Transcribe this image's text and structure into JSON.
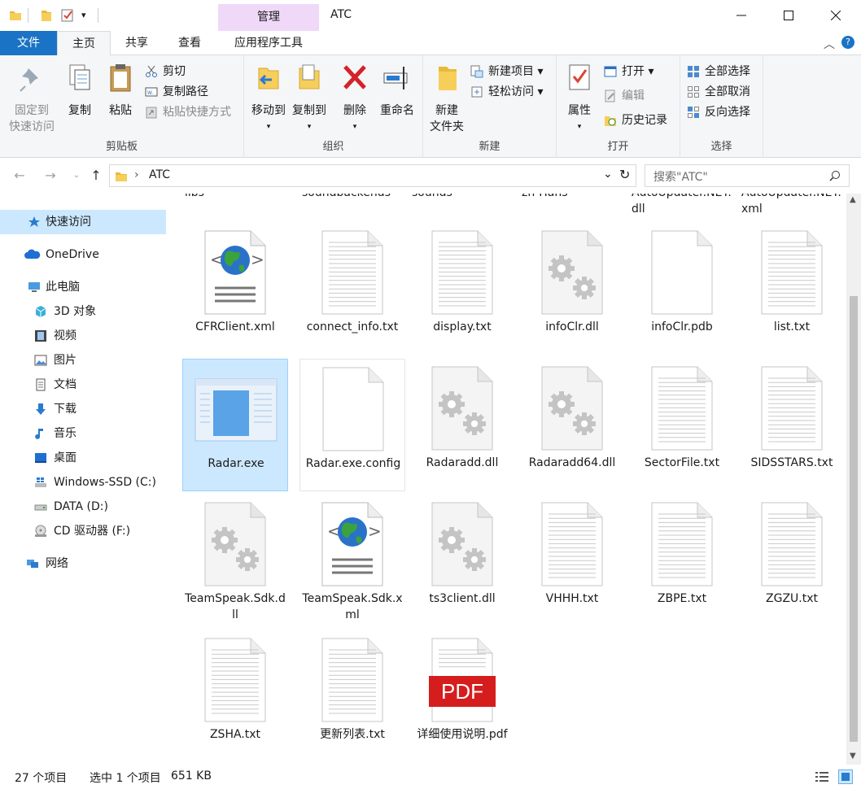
{
  "window": {
    "title": "ATC",
    "context_tab": "管理"
  },
  "tabs": {
    "file": "文件",
    "home": "主页",
    "share": "共享",
    "view": "查看",
    "app_tools": "应用程序工具"
  },
  "ribbon": {
    "clipboard": {
      "label": "剪贴板",
      "pin_line1": "固定到",
      "pin_line2": "快速访问",
      "copy": "复制",
      "paste": "粘贴",
      "cut": "剪切",
      "copy_path": "复制路径",
      "paste_shortcut": "粘贴快捷方式"
    },
    "organize": {
      "label": "组织",
      "move_to": "移动到",
      "copy_to": "复制到",
      "delete": "删除",
      "rename": "重命名"
    },
    "new": {
      "label": "新建",
      "new_folder_line1": "新建",
      "new_folder_line2": "文件夹",
      "new_item": "新建项目",
      "easy_access": "轻松访问"
    },
    "open": {
      "label": "打开",
      "properties": "属性",
      "open": "打开",
      "edit": "编辑",
      "history": "历史记录"
    },
    "select": {
      "label": "选择",
      "select_all": "全部选择",
      "select_none": "全部取消",
      "invert": "反向选择"
    }
  },
  "address": {
    "path": "ATC",
    "search_placeholder": "搜索\"ATC\""
  },
  "nav": {
    "quick_access": "快速访问",
    "onedrive": "OneDrive",
    "this_pc": "此电脑",
    "objects3d": "3D 对象",
    "videos": "视频",
    "pictures": "图片",
    "documents": "文档",
    "downloads": "下载",
    "music": "音乐",
    "desktop": "桌面",
    "drive_c": "Windows-SSD (C:)",
    "drive_d": "DATA (D:)",
    "drive_f": "CD 驱动器 (F:)",
    "network": "网络"
  },
  "files": {
    "partial": [
      "libs",
      "soundbackends",
      "sounds",
      "zh-Hans",
      "AutoUpdater.NET.dll",
      "AutoUpdater.NET.xml"
    ],
    "items": [
      {
        "name": "CFRClient.xml",
        "icon": "xml-globe-icon"
      },
      {
        "name": "connect_info.txt",
        "icon": "text-doc-icon"
      },
      {
        "name": "display.txt",
        "icon": "text-doc-icon"
      },
      {
        "name": "infoClr.dll",
        "icon": "dll-gear-icon"
      },
      {
        "name": "infoClr.pdb",
        "icon": "blank-doc-icon"
      },
      {
        "name": "list.txt",
        "icon": "text-doc-icon"
      },
      {
        "name": "Radar.exe",
        "icon": "exe-window-icon"
      },
      {
        "name": "Radar.exe.config",
        "icon": "blank-doc-icon"
      },
      {
        "name": "Radaradd.dll",
        "icon": "dll-gear-icon"
      },
      {
        "name": "Radaradd64.dll",
        "icon": "dll-gear-icon"
      },
      {
        "name": "SectorFile.txt",
        "icon": "text-doc-icon"
      },
      {
        "name": "SIDSSTARS.txt",
        "icon": "text-doc-icon"
      },
      {
        "name": "TeamSpeak.Sdk.dll",
        "icon": "dll-gear-icon"
      },
      {
        "name": "TeamSpeak.Sdk.xml",
        "icon": "xml-globe-icon"
      },
      {
        "name": "ts3client.dll",
        "icon": "dll-gear-icon"
      },
      {
        "name": "VHHH.txt",
        "icon": "text-doc-icon"
      },
      {
        "name": "ZBPE.txt",
        "icon": "text-doc-icon"
      },
      {
        "name": "ZGZU.txt",
        "icon": "text-doc-icon"
      },
      {
        "name": "ZSHA.txt",
        "icon": "text-doc-icon"
      },
      {
        "name": "更新列表.txt",
        "icon": "text-doc-icon"
      },
      {
        "name": "详细使用说明.pdf",
        "icon": "pdf-icon"
      }
    ],
    "selected": "Radar.exe",
    "pdf_badge": "PDF"
  },
  "status": {
    "count": "27 个项目",
    "selected": "选中 1 个项目",
    "size": "651 KB"
  },
  "colors": {
    "accent": "#1a73c5",
    "selection": "#cce8ff",
    "context_tab": "#f0d8f8"
  }
}
